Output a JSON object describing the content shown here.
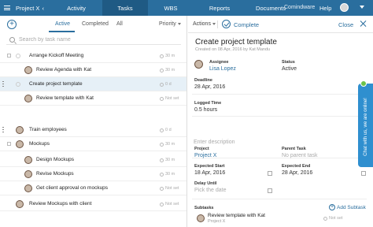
{
  "nav": {
    "project": "Project X",
    "tabs": [
      "Activity",
      "Tasks",
      "WBS",
      "Reports",
      "Documents"
    ],
    "active_tab": "Tasks",
    "brand": "Comindware",
    "help": "Help"
  },
  "left": {
    "tabs": [
      "Active",
      "Completed",
      "All"
    ],
    "active_tab": "Active",
    "sort": "Priority",
    "search_placeholder": "Search by task name",
    "tasks": [
      {
        "title": "Arrange Kickoff Meeting",
        "meta": "30 m"
      },
      {
        "title": "Review Agenda with Kat",
        "meta": "30 m"
      },
      {
        "title": "Create project template",
        "meta": "0 d"
      },
      {
        "title": "Review template with Kat",
        "meta": "Not set"
      },
      {
        "title": "Train employees",
        "meta": "0 d"
      },
      {
        "title": "Mockups",
        "meta": "30 m"
      },
      {
        "title": "Design Mockups",
        "meta": "30 m"
      },
      {
        "title": "Revise Mockups",
        "meta": "30 m"
      },
      {
        "title": "Get client approval on mockups",
        "meta": "Not set"
      },
      {
        "title": "Review Mockups with client",
        "meta": "Not set"
      }
    ]
  },
  "detail": {
    "actions": "Actions",
    "complete": "Complete",
    "close": "Close",
    "title": "Create project template",
    "created": "Created on 08 Apr, 2016  by Kat Mandu",
    "assignee_label": "Assignee",
    "assignee": "Lisa Lopez",
    "status_label": "Status",
    "status": "Active",
    "deadline_label": "Deadline",
    "deadline": "28 Apr, 2016",
    "logged_label": "Logged Time",
    "logged": "0.5 hours",
    "description_placeholder": "Enter description",
    "project_label": "Project",
    "project": "Project X",
    "parent_label": "Parent Task",
    "parent": "No parent task",
    "exp_start_label": "Expected Start",
    "exp_start": "18 Apr, 2016",
    "exp_end_label": "Expected End",
    "exp_end": "28 Apr, 2016",
    "delay_label": "Delay Until",
    "delay": "Pick the date",
    "subtasks_label": "Subtasks",
    "add_subtask": "Add Subtask",
    "subtask_title": "Review template with Kat",
    "subtask_project": "Project X"
  },
  "chat": "Chat with us, we are online!",
  "colors": {
    "nav": "#2a6e9e",
    "accent": "#2a6e9e",
    "chat": "#2f8fcf"
  }
}
